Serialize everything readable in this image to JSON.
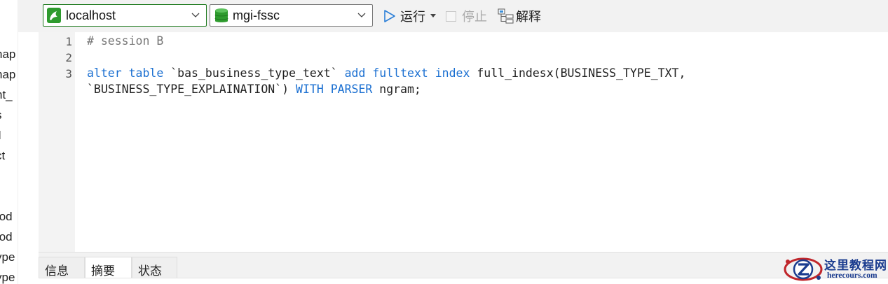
{
  "sidebar": {
    "items": [
      "nap",
      "nap",
      "nt_",
      "s",
      "il",
      "ct",
      "tod",
      "tod",
      "ype",
      "ype"
    ]
  },
  "toolbar": {
    "connection": {
      "value": "localhost",
      "icon": "connection-icon"
    },
    "database": {
      "value": "mgi-fssc",
      "icon": "database-icon"
    },
    "run_label": "运行",
    "stop_label": "停止",
    "explain_label": "解释"
  },
  "editor": {
    "line_numbers": [
      "1",
      "2",
      "3"
    ],
    "comment": "# session B",
    "statement": {
      "kw_alter": "alter",
      "kw_table": "table",
      "table_name": "`bas_business_type_text`",
      "kw_add": "add",
      "kw_fulltext": "fulltext",
      "kw_index": "index",
      "index_def": "full_indesx(BUSINESS_TYPE_TXT,",
      "line2_col": "`BUSINESS_TYPE_EXPLAINATION`)",
      "kw_with": "WITH",
      "kw_parser": "PARSER",
      "parser_name": "ngram;"
    }
  },
  "bottom_tabs": {
    "info": "信息",
    "summary": "摘要",
    "status": "状态",
    "active": "summary"
  },
  "watermark": {
    "title": "这里教程网",
    "url": "herecours.com"
  },
  "colors": {
    "keyword": "#1a6fd1",
    "comment": "#777777",
    "connection_border": "#1e7a1e",
    "watermark": "#1b3c8f"
  }
}
